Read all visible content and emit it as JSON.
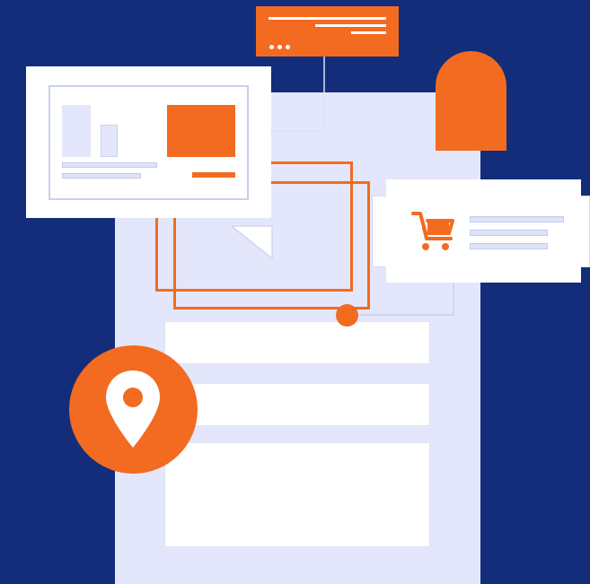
{
  "colors": {
    "background": "#132d7a",
    "page": "#e4e7fb",
    "accent": "#f26b21",
    "line": "#c3c9ec",
    "white": "#ffffff"
  },
  "icons": {
    "pin": "map-pin-icon",
    "cart": "shopping-cart-icon",
    "dots": "more-dots-icon"
  }
}
